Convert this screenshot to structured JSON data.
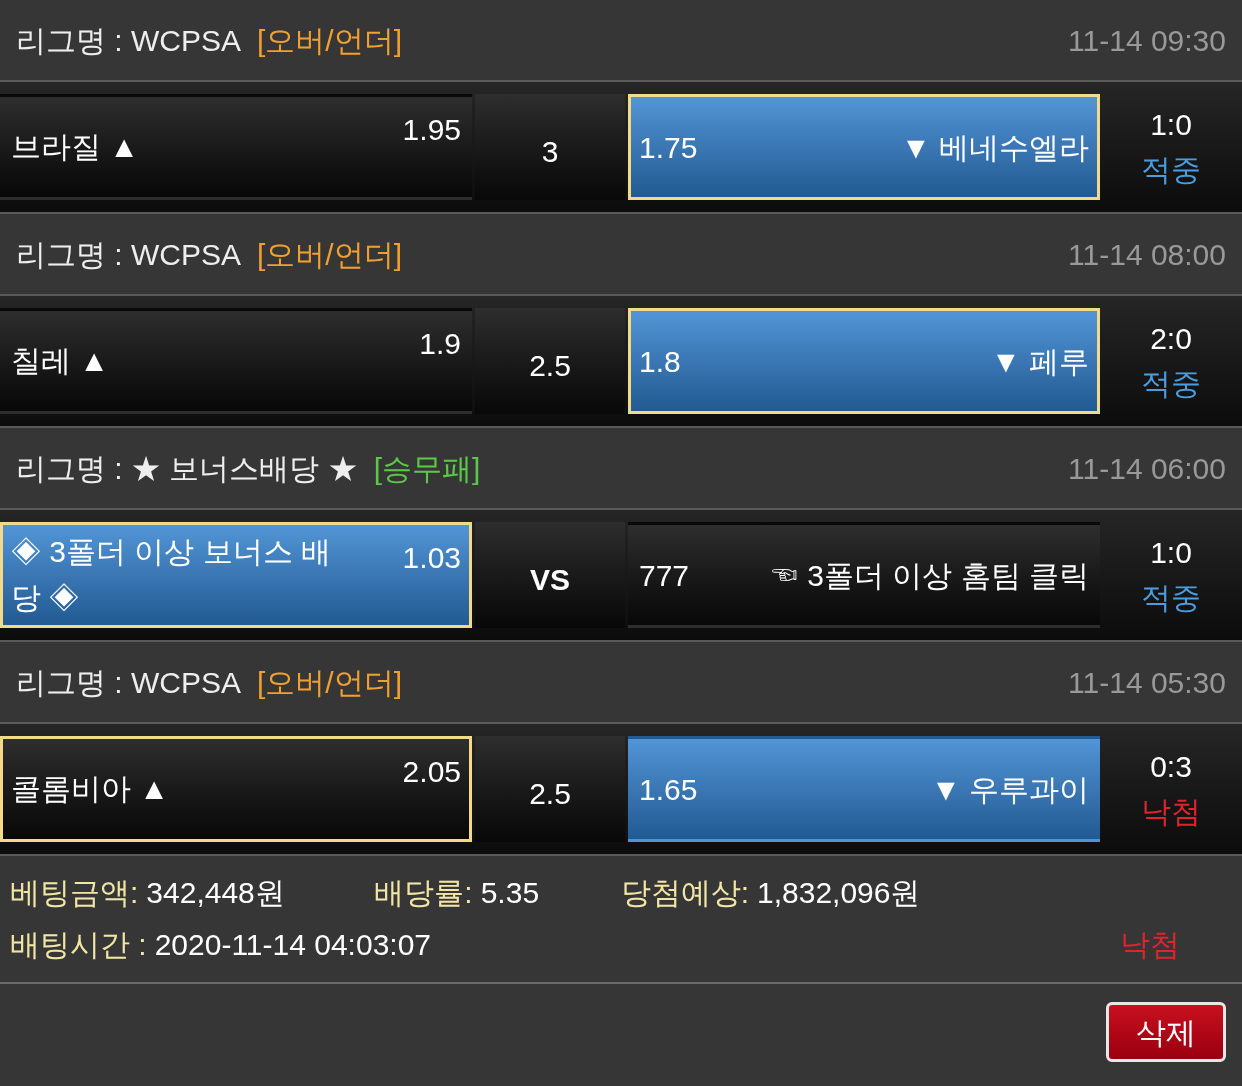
{
  "matches": [
    {
      "league": "리그명 : WCPSA",
      "tag": {
        "text": "[오버/언더]",
        "color": "#f0a030"
      },
      "time": "11-14 09:30",
      "home": {
        "name": "브라질 ▲",
        "odds": "1.95",
        "winning": false,
        "selected": false
      },
      "middle": {
        "text": "3",
        "kind": "line"
      },
      "away": {
        "odds": "1.75",
        "name": "▼ 베네수엘라",
        "winning": true,
        "selected": true
      },
      "score": "1:0",
      "status": {
        "text": "적중",
        "kind": "hit"
      }
    },
    {
      "league": "리그명 : WCPSA",
      "tag": {
        "text": "[오버/언더]",
        "color": "#f0a030"
      },
      "time": "11-14 08:00",
      "home": {
        "name": "칠레 ▲",
        "odds": "1.9",
        "winning": false,
        "selected": false
      },
      "middle": {
        "text": "2.5",
        "kind": "line"
      },
      "away": {
        "odds": "1.8",
        "name": "▼ 페루",
        "winning": true,
        "selected": true
      },
      "score": "2:0",
      "status": {
        "text": "적중",
        "kind": "hit"
      }
    },
    {
      "league": "리그명 : ★ 보너스배당 ★",
      "tag": {
        "text": "[승무패]",
        "color": "#5cc84a"
      },
      "time": "11-14 06:00",
      "home": {
        "name": "◈ 3폴더 이상 보너스 배당 ◈",
        "odds": "1.03",
        "winning": true,
        "selected": true
      },
      "middle": {
        "text": "VS",
        "kind": "vs"
      },
      "away": {
        "odds": "777",
        "name": "☜ 3폴더 이상 홈팀 클릭",
        "winning": false,
        "selected": false
      },
      "score": "1:0",
      "status": {
        "text": "적중",
        "kind": "hit"
      }
    },
    {
      "league": "리그명 : WCPSA",
      "tag": {
        "text": "[오버/언더]",
        "color": "#f0a030"
      },
      "time": "11-14 05:30",
      "home": {
        "name": "콜롬비아 ▲",
        "odds": "2.05",
        "winning": false,
        "selected": true
      },
      "middle": {
        "text": "2.5",
        "kind": "line"
      },
      "away": {
        "odds": "1.65",
        "name": "▼ 우루과이",
        "winning": true,
        "selected": false
      },
      "score": "0:3",
      "status": {
        "text": "낙첨",
        "kind": "miss"
      }
    }
  ],
  "summary": {
    "amount_label": "베팅금액:",
    "amount": "342,448원",
    "rate_label": "배당률:",
    "rate": "5.35",
    "expected_label": "당첨예상:",
    "expected": "1,832,096원",
    "time_label": "배팅시간 :",
    "time": "2020-11-14 04:03:07",
    "status": {
      "text": "낙첨",
      "kind": "miss"
    }
  },
  "delete_button": "삭제"
}
